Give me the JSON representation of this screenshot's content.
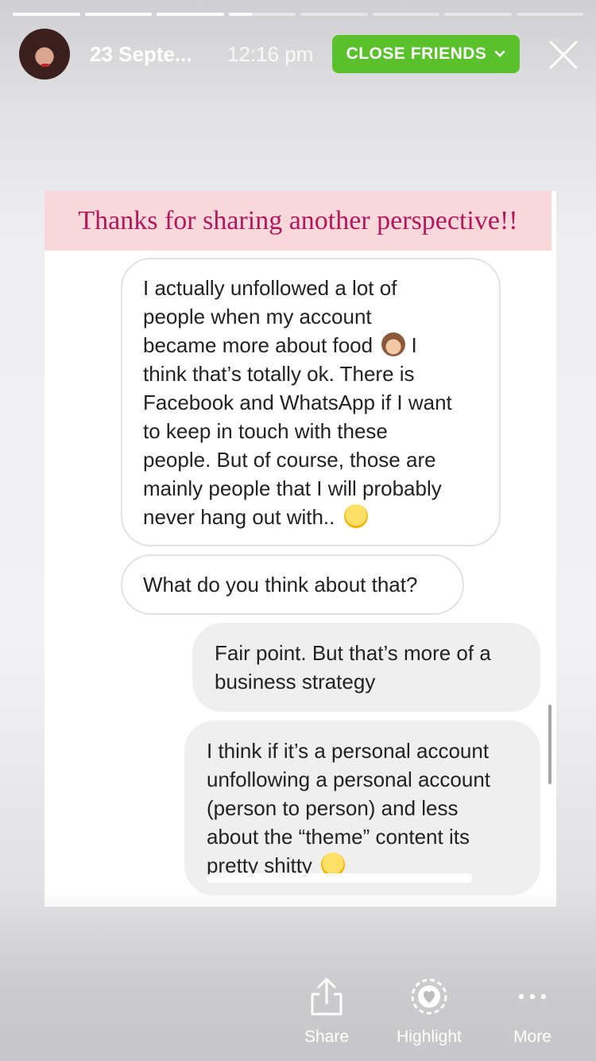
{
  "story": {
    "segment_count": 8,
    "completed_segments": 3,
    "current_segment_progress": 0.35
  },
  "header": {
    "date": "23 Septe...",
    "time": "12:16 pm",
    "audience_label": "CLOSE FRIENDS",
    "avatar": "profile-photo",
    "close_icon": "close-icon"
  },
  "card": {
    "banner": "Thanks for sharing another perspective!!",
    "messages": [
      {
        "side": "in",
        "lines": [
          "I actually unfollowed a lot of",
          "people when my account",
          "became more about food",
          "think that’s totally ok. There is",
          "Facebook and WhatsApp if I want",
          "to keep in touch with these",
          "people. But of course, those are",
          "mainly people that I will probably",
          "never hang out with.."
        ],
        "line3_tail": "I",
        "emojis": [
          "see-no-evil-monkey",
          "grinning-sweat"
        ]
      },
      {
        "side": "in",
        "text": "What do you think about that?"
      },
      {
        "side": "out",
        "lines": [
          "Fair point. But that’s more of a",
          "business strategy"
        ]
      },
      {
        "side": "out",
        "lines": [
          "I think if it’s a personal account",
          "unfollowing a personal account",
          "(person to person) and less",
          "about the “theme” content its",
          "pretty shitty"
        ],
        "emojis": [
          "expressionless-face"
        ]
      }
    ]
  },
  "actions": [
    {
      "label": "Share",
      "icon": "share-icon"
    },
    {
      "label": "Highlight",
      "icon": "highlight-icon"
    },
    {
      "label": "More",
      "icon": "more-icon"
    }
  ],
  "colors": {
    "close_friends": "#5ac02b",
    "banner_bg": "#f9d8dc",
    "banner_text": "#b2185b",
    "outgoing_bubble": "#efefef"
  }
}
